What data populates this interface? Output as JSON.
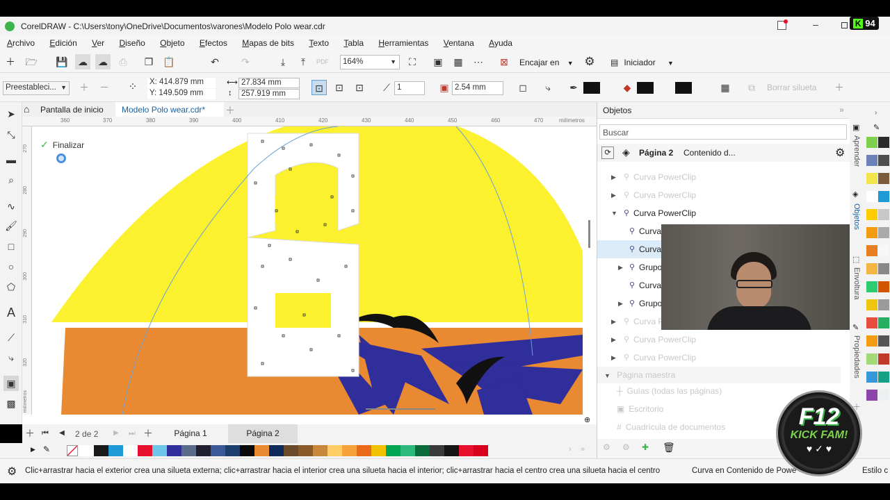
{
  "window": {
    "title": "CorelDRAW - C:\\Users\\tony\\OneDrive\\Documentos\\varones\\Modelo Polo wear.cdr",
    "overlay_count": "94"
  },
  "menu": [
    "Archivo",
    "Edición",
    "Ver",
    "Diseño",
    "Objeto",
    "Efectos",
    "Mapas de bits",
    "Texto",
    "Tabla",
    "Herramientas",
    "Ventana",
    "Ayuda"
  ],
  "toolbar1": {
    "zoom": "164%",
    "snap": "Encajar en",
    "launch": "Iniciador"
  },
  "toolbar2": {
    "preset": "Preestableci...",
    "x": "X: 414.879 mm",
    "y": "Y: 149.509 mm",
    "w": "27.834 mm",
    "h": "257.919 mm",
    "steps": "1",
    "offset": "2.54 mm",
    "clear": "Borrar silueta"
  },
  "tabs": {
    "home": "Pantalla de inicio",
    "doc": "Modelo Polo wear.cdr*"
  },
  "ruler": {
    "ticks": [
      "360",
      "370",
      "380",
      "390",
      "400",
      "410",
      "420",
      "430",
      "440",
      "450",
      "460",
      "470"
    ],
    "unit": "milímetros",
    "vticks": [
      "270",
      "280",
      "290",
      "300",
      "310",
      "320"
    ],
    "vunit": "milímetros"
  },
  "canvas": {
    "finish": "Finalizar"
  },
  "pagebar": {
    "page_of": "2",
    "of_label": "de",
    "total": "2",
    "pages": [
      "Página 1",
      "Página 2"
    ]
  },
  "objects": {
    "title": "Objetos",
    "search_placeholder": "Buscar",
    "page": "Página 2",
    "content": "Contenido d...",
    "items": [
      {
        "label": "Curva PowerClip",
        "ghost": true
      },
      {
        "label": "Curva PowerClip",
        "ghost": true
      },
      {
        "label": "Curva PowerClip",
        "ghost": false
      },
      {
        "label": "Curva",
        "ghost": false
      },
      {
        "label": "Curva",
        "ghost": false
      },
      {
        "label": "Grupo",
        "ghost": false
      },
      {
        "label": "Curva",
        "ghost": false
      },
      {
        "label": "Grupo",
        "ghost": false
      },
      {
        "label": "Curva P",
        "ghost": true
      },
      {
        "label": "Curva PowerClip",
        "ghost": true
      },
      {
        "label": "Curva PowerClip",
        "ghost": true
      }
    ],
    "master": "Página maestra",
    "master_items": [
      "Guías (todas las páginas)",
      "Escritorio",
      "Cuadrícula de documentos"
    ]
  },
  "dock_tabs": [
    "Aprender",
    "Objetos",
    "Envoltura",
    "Propiedades"
  ],
  "status": {
    "hint": "Clic+arrastrar hacia el exterior crea una silueta externa; clic+arrastrar hacia el interior crea una silueta hacia el interior; clic+arrastrar hacia el centro crea una silueta hacia el centro",
    "selection": "Curva en Contenido de Powe",
    "style": "Estilo c"
  },
  "watermark": {
    "line1": "F12",
    "line2": "KICK FAM!"
  },
  "colors": {
    "yellow": "#fbf12f",
    "orange": "#e98a32",
    "purple": "#2f2e9a",
    "accent": "#4caf50"
  },
  "palette_bottom": [
    "#ffffff",
    "#1a1a1a",
    "#1e9ad6",
    "#ffffff",
    "#e8112d",
    "#6ec6ea",
    "#2f2e9a",
    "#5b6b8c",
    "#202030",
    "#3b5998",
    "#1c3f6e",
    "#0a0a0a",
    "#e98a32",
    "#0d2a5a",
    "#6b4a2a",
    "#8a5a2a",
    "#c8873a",
    "#ffcc66",
    "#f7a23b",
    "#e86a1a",
    "#f2c200",
    "#00a651",
    "#2db87c",
    "#0b6b3a",
    "#3a3a3a",
    "#151515",
    "#e8112d",
    "#d9001b"
  ],
  "palette_right": [
    "#7fd04c",
    "#2b2b2b",
    "#6b82b8",
    "#4d4d4d",
    "#f2e54a",
    "#7a5c3c",
    "#ffffff",
    "#1e9ad6",
    "#ffcc00",
    "#c8c8c8",
    "#f39c12",
    "#aaaaaa",
    "#e67e22",
    "#f7f7f7",
    "#f4b642",
    "#888888",
    "#2ecc71",
    "#d35400",
    "#f1c40f",
    "#9b9b9b",
    "#e74c3c",
    "#27ae60",
    "#f39c12",
    "#555555",
    "#a3d977",
    "#c0392b",
    "#3498db",
    "#16a085",
    "#8e44ad",
    "#ecf0f1"
  ]
}
